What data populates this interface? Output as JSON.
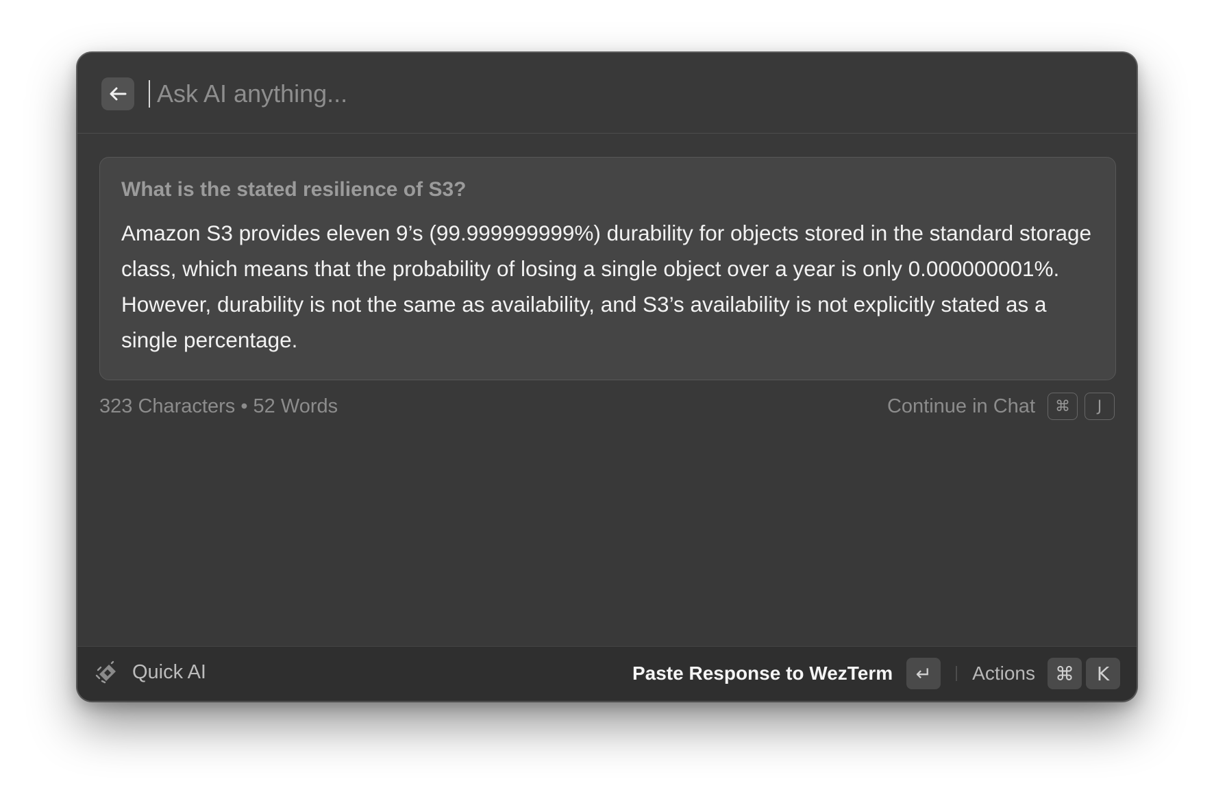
{
  "header": {
    "back_icon": "arrow-left-icon",
    "search_placeholder": "Ask AI anything...",
    "search_value": ""
  },
  "conversation": {
    "question": "What is the stated resilience of S3?",
    "answer": "Amazon S3 provides eleven 9’s (99.999999999%) durability for objects stored in the standard storage class, which means that the probability of losing a single object over a year is only 0.000000001%. However, durability is not the same as availability, and S3’s availability is not explicitly stated as a single percentage."
  },
  "stats": {
    "text": "323 Characters • 52 Words"
  },
  "continue_chat": {
    "label": "Continue in Chat",
    "shortcut": [
      "⌘",
      "J"
    ]
  },
  "footer": {
    "brand_icon": "quick-ai-sparkle-icon",
    "brand_label": "Quick AI",
    "primary_action_label": "Paste Response to WezTerm",
    "primary_shortcut": "↵",
    "secondary_action_label": "Actions",
    "secondary_shortcut": [
      "⌘",
      "K"
    ]
  },
  "colors": {
    "window_bg": "#393939",
    "card_bg": "#454545",
    "footer_bg": "#2f2f2f",
    "text_primary": "#f2f2f2",
    "text_muted": "#8c8c8c"
  }
}
